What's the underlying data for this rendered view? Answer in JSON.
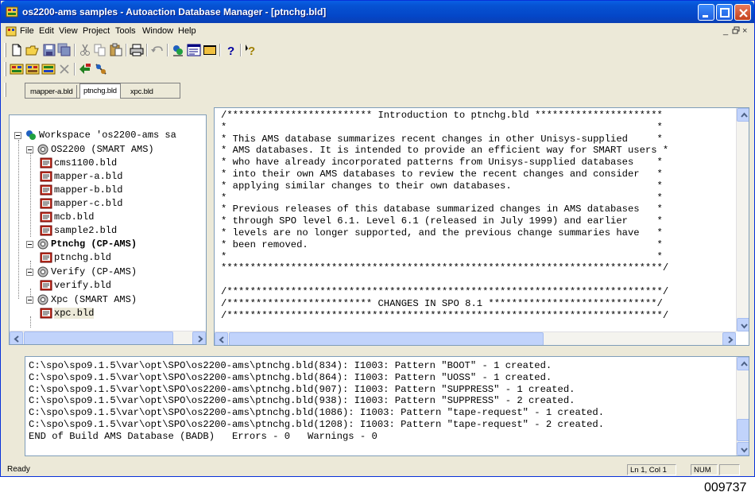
{
  "window": {
    "title": "os2200-ams samples - Autoaction Database Manager - [ptnchg.bld]"
  },
  "menu": {
    "items": [
      {
        "id": "file",
        "label": "File"
      },
      {
        "id": "edit",
        "label": "Edit"
      },
      {
        "id": "view",
        "label": "View"
      },
      {
        "id": "project",
        "label": "Project"
      },
      {
        "id": "tools",
        "label": "Tools"
      },
      {
        "id": "window",
        "label": "Window"
      },
      {
        "id": "help",
        "label": "Help"
      }
    ],
    "mdi_minimize": "_",
    "mdi_restore": "×"
  },
  "toolbar1": {
    "icons": [
      "new-icon",
      "open-icon",
      "save-icon",
      "save-all-icon",
      "cut-icon",
      "copy-icon",
      "paste-icon",
      "print-icon",
      "undo-icon",
      "workspace-icon",
      "output-icon",
      "fullscreen-icon",
      "help-icon",
      "context-help-icon"
    ]
  },
  "toolbar2": {
    "icons": [
      "build-icon",
      "rebuild-icon",
      "build-all-icon",
      "stop-build-icon",
      "find-next-icon",
      "find-prev-icon"
    ]
  },
  "tabs": [
    {
      "label": "mapper-a.bld",
      "active": false
    },
    {
      "label": "ptnchg.bld",
      "active": true
    },
    {
      "label": "xpc.bld",
      "active": false
    }
  ],
  "workspace_tree": {
    "root": "Workspace 'os2200-ams sa",
    "projects": [
      {
        "label": "OS2200 (SMART AMS)",
        "bold": false,
        "files": [
          "cms1100.bld",
          "mapper-a.bld",
          "mapper-b.bld",
          "mapper-c.bld",
          "mcb.bld",
          "sample2.bld"
        ]
      },
      {
        "label": "Ptnchg (CP-AMS)",
        "bold": true,
        "files": [
          "ptnchg.bld"
        ]
      },
      {
        "label": "Verify (CP-AMS)",
        "bold": false,
        "files": [
          "verify.bld"
        ]
      },
      {
        "label": "Xpc (SMART AMS)",
        "bold": false,
        "files": [
          "xpc.bld"
        ]
      }
    ]
  },
  "editor": {
    "lines": [
      "/************************* Introduction to ptnchg.bld **********************",
      "*                                                                          *",
      "* This AMS database summarizes recent changes in other Unisys-supplied     *",
      "* AMS databases. It is intended to provide an efficient way for SMART users *",
      "* who have already incorporated patterns from Unisys-supplied databases    *",
      "* into their own AMS databases to review the recent changes and consider   *",
      "* applying similar changes to their own databases.                         *",
      "*                                                                          *",
      "* Previous releases of this database summarized changes in AMS databases   *",
      "* through SPO level 6.1. Level 6.1 (released in July 1999) and earlier     *",
      "* levels are no longer supported, and the previous change summaries have   *",
      "* been removed.                                                            *",
      "*                                                                          *",
      "****************************************************************************/",
      "",
      "/***************************************************************************/",
      "/************************* CHANGES IN SPO 8.1 *****************************/",
      "/***************************************************************************/"
    ]
  },
  "output": {
    "lines": [
      "C:\\spo\\spo9.1.5\\var\\opt\\SPO\\os2200-ams\\ptnchg.bld(834): I1003: Pattern \"BOOT\" - 1 created.",
      "C:\\spo\\spo9.1.5\\var\\opt\\SPO\\os2200-ams\\ptnchg.bld(864): I1003: Pattern \"UOSS\" - 1 created.",
      "C:\\spo\\spo9.1.5\\var\\opt\\SPO\\os2200-ams\\ptnchg.bld(907): I1003: Pattern \"SUPPRESS\" - 1 created.",
      "C:\\spo\\spo9.1.5\\var\\opt\\SPO\\os2200-ams\\ptnchg.bld(938): I1003: Pattern \"SUPPRESS\" - 2 created.",
      "C:\\spo\\spo9.1.5\\var\\opt\\SPO\\os2200-ams\\ptnchg.bld(1086): I1003: Pattern \"tape-request\" - 1 created.",
      "C:\\spo\\spo9.1.5\\var\\opt\\SPO\\os2200-ams\\ptnchg.bld(1208): I1003: Pattern \"tape-request\" - 2 created.",
      "END of Build AMS Database (BADB)   Errors - 0   Warnings - 0"
    ]
  },
  "status": {
    "text": "Ready",
    "position": "Ln 1, Col 1",
    "num": "NUM"
  },
  "figure_id": "009737",
  "colors": {
    "titlebar": "#0653d4",
    "chrome": "#ece9d8",
    "pane_border": "#7f9db9",
    "scroll": "#c1d3fb"
  }
}
